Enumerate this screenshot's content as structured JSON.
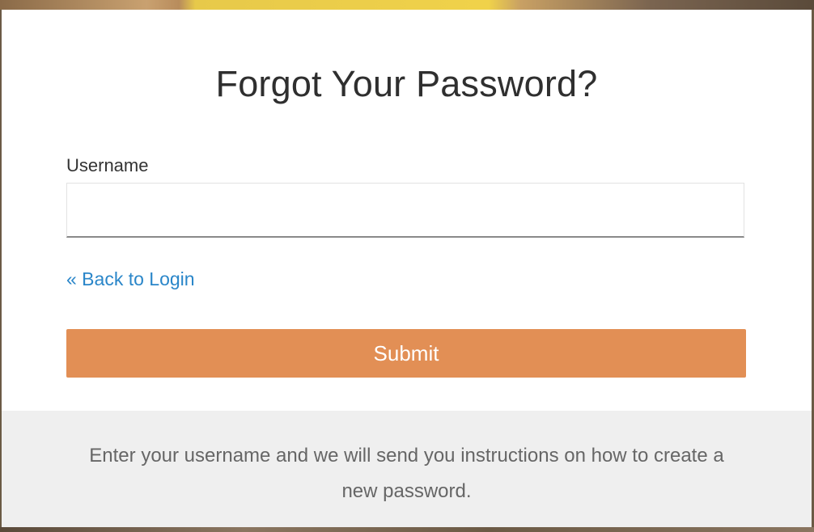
{
  "modal": {
    "title": "Forgot Your Password?",
    "username_label": "Username",
    "username_value": "",
    "username_placeholder": "",
    "back_link": "« Back to Login",
    "submit_label": "Submit",
    "footer_text": "Enter your username and we will send you instructions on how to create a new password."
  },
  "colors": {
    "accent": "#e28f55",
    "link": "#2a86c9",
    "footer_bg": "#efefef"
  }
}
